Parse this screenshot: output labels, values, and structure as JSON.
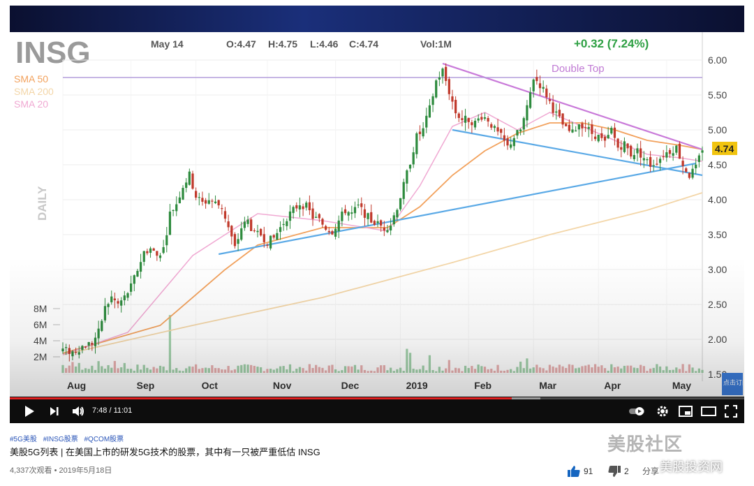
{
  "chart_data": {
    "type": "candlestick",
    "ticker": "INSG",
    "period": "DAILY",
    "info": {
      "date": "May 14",
      "open": "O:4.47",
      "high": "H:4.75",
      "low": "L:4.46",
      "close": "C:4.74",
      "volume": "Vol:1M",
      "change": "+0.32 (7.24%)"
    },
    "last_price": "4.74",
    "annotation": "Double Top",
    "sma": [
      {
        "name": "SMA 50",
        "color": "#f2a15c"
      },
      {
        "name": "SMA 200",
        "color": "#f3d6a8"
      },
      {
        "name": "SMA 20",
        "color": "#f0a8d2"
      }
    ],
    "ylim": [
      1.5,
      6.0
    ],
    "y_ticks": [
      "6.00",
      "5.50",
      "5.00",
      "4.50",
      "4.00",
      "3.50",
      "3.00",
      "2.50",
      "2.00",
      "1.50"
    ],
    "volume_ticks": [
      "8M",
      "6M",
      "4M",
      "2M"
    ],
    "months": [
      "Aug",
      "Sep",
      "Oct",
      "Nov",
      "Dec",
      "2019",
      "Feb",
      "Mar",
      "Apr",
      "May"
    ],
    "close_path": [
      [
        0,
        1.85
      ],
      [
        3,
        1.82
      ],
      [
        6,
        1.9
      ],
      [
        9,
        1.95
      ],
      [
        11,
        2.1
      ],
      [
        13,
        2.45
      ],
      [
        15,
        2.6
      ],
      [
        17,
        2.5
      ],
      [
        19,
        2.6
      ],
      [
        21,
        2.75
      ],
      [
        23,
        3.0
      ],
      [
        25,
        3.25
      ],
      [
        27,
        3.3
      ],
      [
        29,
        3.2
      ],
      [
        31,
        3.3
      ],
      [
        33,
        3.8
      ],
      [
        35,
        3.95
      ],
      [
        37,
        4.2
      ],
      [
        39,
        4.35
      ],
      [
        41,
        4.05
      ],
      [
        43,
        3.95
      ],
      [
        45,
        4.0
      ],
      [
        47,
        3.95
      ],
      [
        49,
        3.9
      ],
      [
        51,
        3.6
      ],
      [
        53,
        3.3
      ],
      [
        55,
        3.6
      ],
      [
        57,
        3.7
      ],
      [
        59,
        3.5
      ],
      [
        61,
        3.5
      ],
      [
        63,
        3.4
      ],
      [
        65,
        3.45
      ],
      [
        67,
        3.6
      ],
      [
        69,
        3.75
      ],
      [
        71,
        3.85
      ],
      [
        73,
        3.95
      ],
      [
        75,
        3.9
      ],
      [
        77,
        3.75
      ],
      [
        79,
        3.7
      ],
      [
        81,
        3.6
      ],
      [
        83,
        3.55
      ],
      [
        85,
        3.7
      ],
      [
        87,
        3.85
      ],
      [
        89,
        3.8
      ],
      [
        91,
        3.9
      ],
      [
        93,
        3.8
      ],
      [
        95,
        3.7
      ],
      [
        97,
        3.65
      ],
      [
        99,
        3.6
      ],
      [
        101,
        3.65
      ],
      [
        103,
        3.9
      ],
      [
        105,
        4.2
      ],
      [
        107,
        4.55
      ],
      [
        109,
        4.9
      ],
      [
        111,
        5.0
      ],
      [
        113,
        5.3
      ],
      [
        115,
        5.7
      ],
      [
        117,
        5.85
      ],
      [
        119,
        5.55
      ],
      [
        121,
        5.25
      ],
      [
        123,
        5.15
      ],
      [
        125,
        5.15
      ],
      [
        127,
        5.1
      ],
      [
        129,
        5.2
      ],
      [
        131,
        5.15
      ],
      [
        133,
        5.0
      ],
      [
        135,
        4.9
      ],
      [
        137,
        4.75
      ],
      [
        139,
        4.9
      ],
      [
        141,
        5.0
      ],
      [
        143,
        5.3
      ],
      [
        145,
        5.75
      ],
      [
        147,
        5.65
      ],
      [
        149,
        5.5
      ],
      [
        151,
        5.3
      ],
      [
        153,
        5.15
      ],
      [
        155,
        5.0
      ],
      [
        157,
        4.95
      ],
      [
        159,
        5.1
      ],
      [
        161,
        5.05
      ],
      [
        163,
        4.95
      ],
      [
        165,
        4.9
      ],
      [
        167,
        4.8
      ],
      [
        169,
        5.0
      ],
      [
        171,
        4.75
      ],
      [
        173,
        4.8
      ],
      [
        175,
        4.65
      ],
      [
        177,
        4.7
      ],
      [
        179,
        4.6
      ],
      [
        181,
        4.5
      ],
      [
        183,
        4.55
      ],
      [
        185,
        4.65
      ],
      [
        187,
        4.7
      ],
      [
        189,
        4.75
      ],
      [
        191,
        4.5
      ],
      [
        193,
        4.35
      ],
      [
        195,
        4.45
      ],
      [
        197,
        4.74
      ]
    ],
    "sma20_path": [
      [
        0,
        1.78
      ],
      [
        20,
        2.1
      ],
      [
        40,
        3.2
      ],
      [
        60,
        3.8
      ],
      [
        80,
        3.7
      ],
      [
        100,
        3.55
      ],
      [
        110,
        4.2
      ],
      [
        120,
        5.05
      ],
      [
        130,
        5.25
      ],
      [
        140,
        5.0
      ],
      [
        150,
        5.25
      ],
      [
        160,
        5.05
      ],
      [
        170,
        4.85
      ],
      [
        180,
        4.65
      ],
      [
        190,
        4.6
      ],
      [
        197,
        4.55
      ]
    ],
    "sma50_path": [
      [
        0,
        1.8
      ],
      [
        30,
        2.2
      ],
      [
        50,
        3.0
      ],
      [
        60,
        3.35
      ],
      [
        80,
        3.6
      ],
      [
        100,
        3.6
      ],
      [
        110,
        3.9
      ],
      [
        120,
        4.35
      ],
      [
        130,
        4.7
      ],
      [
        140,
        4.95
      ],
      [
        150,
        5.1
      ],
      [
        160,
        5.1
      ],
      [
        170,
        5.0
      ],
      [
        180,
        4.85
      ],
      [
        190,
        4.78
      ],
      [
        197,
        4.72
      ]
    ],
    "sma200_path": [
      [
        0,
        1.78
      ],
      [
        40,
        2.2
      ],
      [
        80,
        2.6
      ],
      [
        120,
        3.1
      ],
      [
        150,
        3.5
      ],
      [
        180,
        3.85
      ],
      [
        197,
        4.1
      ]
    ],
    "trend_support": [
      [
        48,
        3.22
      ],
      [
        195,
        4.52
      ]
    ],
    "trend_lower": [
      [
        120,
        5.0
      ],
      [
        197,
        4.35
      ]
    ],
    "trend_upper": [
      [
        117,
        5.95
      ],
      [
        197,
        4.72
      ]
    ],
    "double_top_level": 5.75
  },
  "controls": {
    "time": "7:48 / 11:01",
    "play_icon": "play-icon",
    "next_icon": "next-icon",
    "volume_icon": "volume-icon",
    "autoplay_icon": "autoplay-toggle-icon",
    "settings_icon": "gear-icon",
    "miniplayer_icon": "miniplayer-icon",
    "theater_icon": "theater-icon",
    "fullscreen_icon": "fullscreen-icon"
  },
  "subscribe_badge": "点击订阅",
  "video": {
    "tags": [
      "#5G美股",
      "#INSG股票",
      "#QCOM股票"
    ],
    "title": "美股5G列表 | 在美国上市的研发5G技术的股票，其中有一只被严重低估 INSG",
    "meta": "4,337次观看 • 2019年5月18日",
    "likes": "91",
    "dislikes": "2",
    "share": "分享"
  },
  "watermark": {
    "main": "美股社区",
    "sub": "美股投资网"
  }
}
